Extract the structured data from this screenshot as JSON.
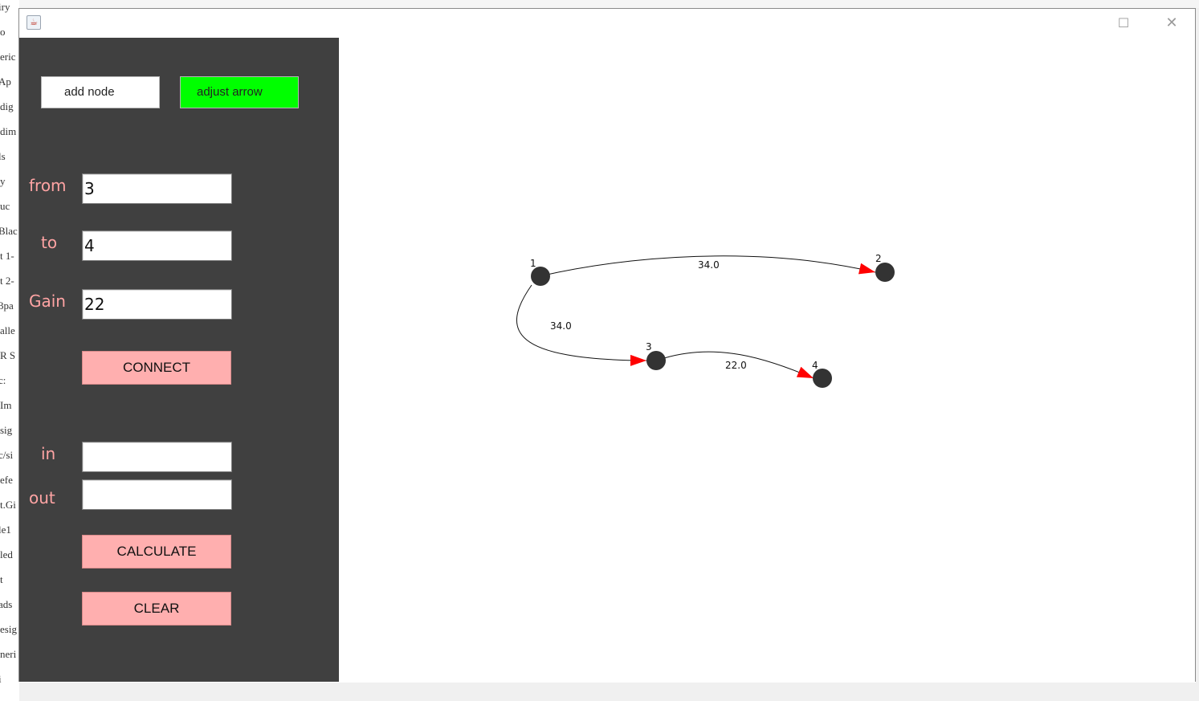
{
  "background": {
    "left_fragments": [
      "iry",
      "o",
      "eric",
      "Ap",
      "dig",
      "dim",
      "ls",
      "y",
      "uc",
      "Blac",
      "t 1-",
      "t 2-",
      "3pa",
      "alle",
      "R S",
      "c:",
      "Im",
      "sig",
      "c/si",
      "efe",
      "t.Gi",
      "le1",
      "led",
      "t",
      "ads",
      "esig",
      "neri",
      "i"
    ]
  },
  "window": {
    "title": "",
    "maximize_glyph": "☐",
    "close_glyph": "✕"
  },
  "panel": {
    "add_node_label": "add node",
    "adjust_arrow_label": "adjust arrow",
    "from_label": "from",
    "from_value": "3",
    "to_label": "to",
    "to_value": "4",
    "gain_label": "Gain",
    "gain_value": "22",
    "connect_label": "CONNECT",
    "in_label": "in",
    "in_value": "",
    "out_label": "out",
    "out_value": "",
    "calculate_label": "CALCULATE",
    "clear_label": "CLEAR"
  },
  "colors": {
    "panel_bg": "#404040",
    "label_pink": "#ffa4a4",
    "button_pink": "#ffafaf",
    "active_green": "#00ff00",
    "node": "#333333",
    "arrow": "#ff0000"
  },
  "graph": {
    "nodes": [
      {
        "id": "1",
        "label": "1"
      },
      {
        "id": "2",
        "label": "2"
      },
      {
        "id": "3",
        "label": "3"
      },
      {
        "id": "4",
        "label": "4"
      }
    ],
    "edges": [
      {
        "from": "1",
        "to": "2",
        "gain": "34.0"
      },
      {
        "from": "1",
        "to": "3",
        "gain": "34.0"
      },
      {
        "from": "3",
        "to": "4",
        "gain": "22.0"
      }
    ]
  }
}
